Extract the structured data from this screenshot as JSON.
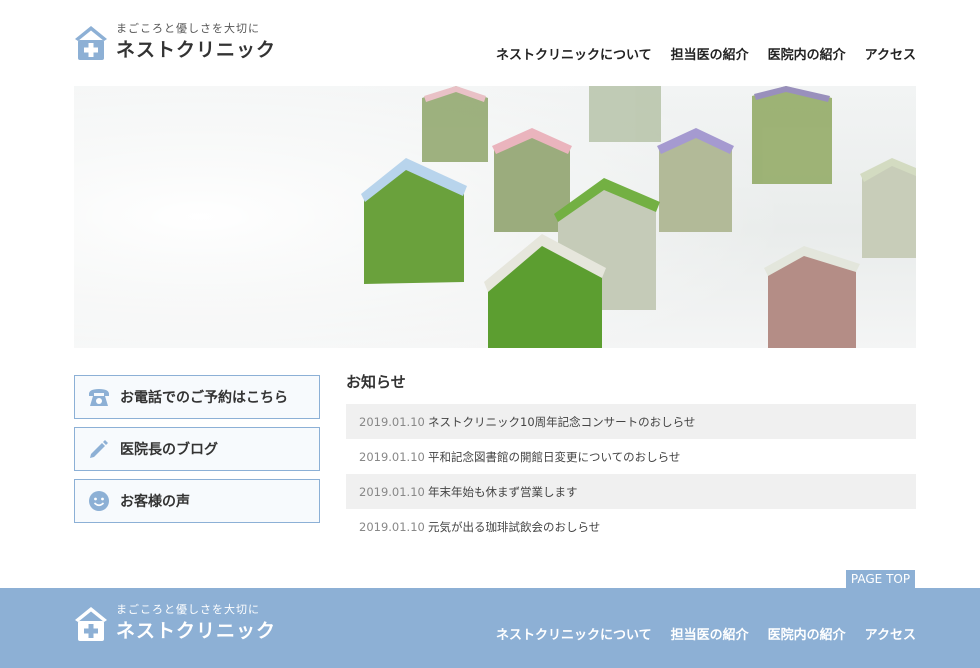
{
  "header": {
    "tagline": "まごころと優しさを大切に",
    "site_name": "ネストクリニック",
    "nav": [
      "ネストクリニックについて",
      "担当医の紹介",
      "医院内の紹介",
      "アクセス"
    ]
  },
  "side_buttons": [
    {
      "label": "お電話でのご予約はこちら",
      "icon": "phone-icon"
    },
    {
      "label": "医院長のブログ",
      "icon": "pencil-icon"
    },
    {
      "label": "お客様の声",
      "icon": "smiley-icon"
    }
  ],
  "news": {
    "title": "お知らせ",
    "items": [
      {
        "date": "2019.01.10",
        "text": "ネストクリニック10周年記念コンサートのおしらせ"
      },
      {
        "date": "2019.01.10",
        "text": "平和記念図書館の開館日変更についてのおしらせ"
      },
      {
        "date": "2019.01.10",
        "text": "年末年始も休まず営業します"
      },
      {
        "date": "2019.01.10",
        "text": "元気が出る珈琲試飲会のおしらせ"
      }
    ]
  },
  "page_top": "PAGE TOP",
  "footer": {
    "tagline": "まごころと優しさを大切に",
    "site_name": "ネストクリニック",
    "nav": [
      "ネストクリニックについて",
      "担当医の紹介",
      "医院内の紹介",
      "アクセス"
    ]
  },
  "colors": {
    "accent": "#8db0d5",
    "border": "#8cb0d6"
  }
}
